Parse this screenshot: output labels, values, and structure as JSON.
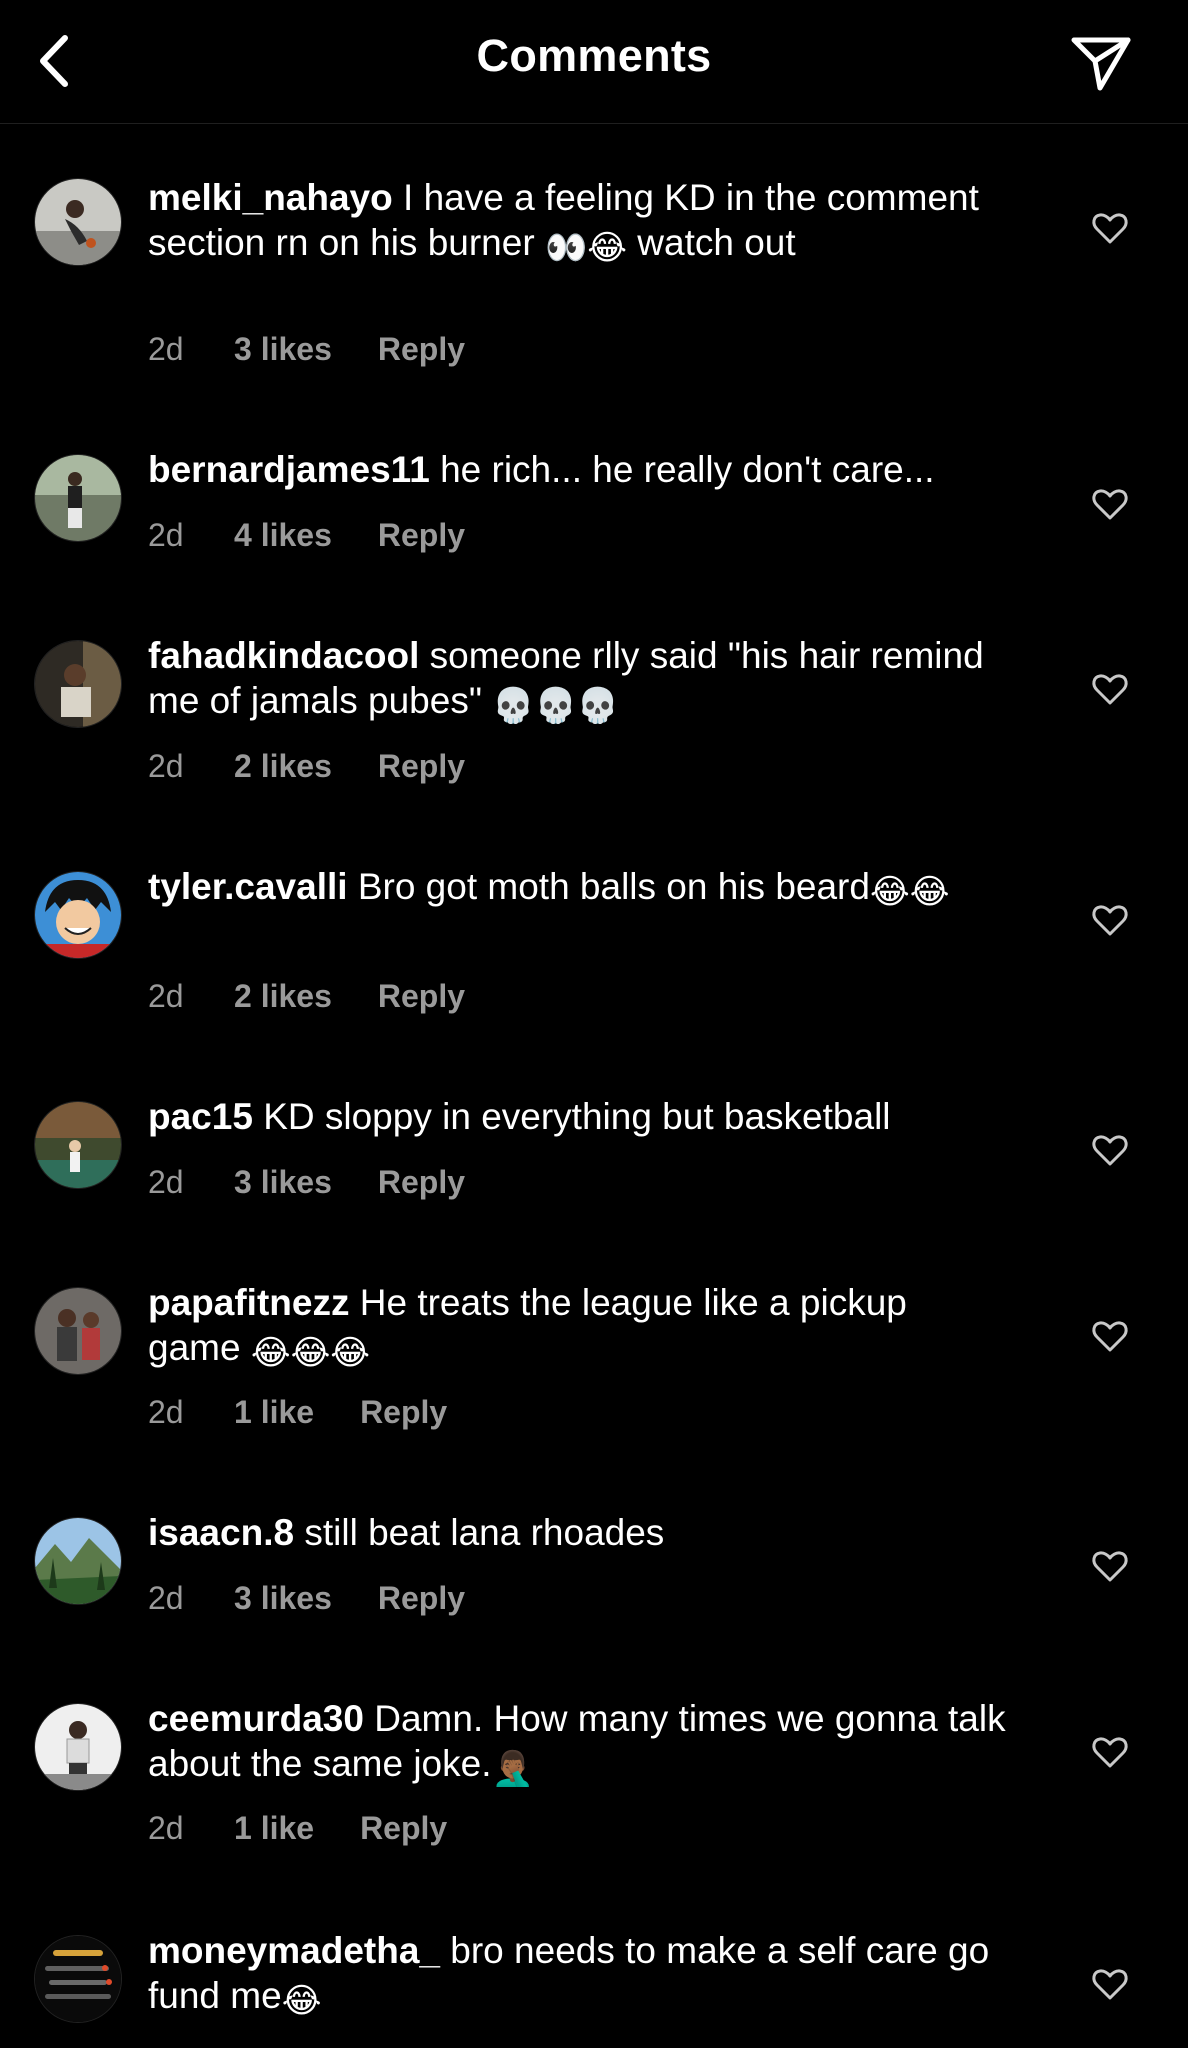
{
  "header": {
    "title": "Comments",
    "back_icon": "chevron-left-icon",
    "share_icon": "paper-plane-icon"
  },
  "colors": {
    "background": "#000000",
    "text": "#ffffff",
    "meta": "#9a9a9a",
    "divider": "#1f1f1f"
  },
  "comments": [
    {
      "username": "melki_nahayo",
      "text_a": "I have a feeling KD in the comment section rn on his burner",
      "emoji_a": "👀😂",
      "text_b": "watch out",
      "time": "2d",
      "likes": "3 likes",
      "reply": "Reply"
    },
    {
      "username": "bernardjames11",
      "text_a": "he rich... he really don't care...",
      "time": "2d",
      "likes": "4 likes",
      "reply": "Reply"
    },
    {
      "username": "fahadkindacool",
      "text_a": "someone rlly said \"his hair remind me of jamals pubes\"",
      "emoji_a": "💀💀💀",
      "time": "2d",
      "likes": "2 likes",
      "reply": "Reply"
    },
    {
      "username": "tyler.cavalli",
      "text_a": "Bro got moth balls on his beard",
      "emoji_a": "😂😂",
      "time": "2d",
      "likes": "2 likes",
      "reply": "Reply"
    },
    {
      "username": "pac15",
      "text_a": "KD sloppy in everything but basketball",
      "time": "2d",
      "likes": "3 likes",
      "reply": "Reply"
    },
    {
      "username": "papafitnezz",
      "text_a": "He treats the league like a pickup game",
      "emoji_a": "😂😂😂",
      "time": "2d",
      "likes": "1 like",
      "reply": "Reply"
    },
    {
      "username": "isaacn.8",
      "text_a": "still beat lana rhoades",
      "time": "2d",
      "likes": "3 likes",
      "reply": "Reply"
    },
    {
      "username": "ceemurda30",
      "text_a": "Damn. How many times we gonna talk about the same joke.",
      "emoji_a": "🤦🏾‍♂️",
      "time": "2d",
      "likes": "1 like",
      "reply": "Reply"
    },
    {
      "username": "moneymadetha_",
      "text_a": "bro needs to make a self care go fund me",
      "emoji_a": "😂"
    }
  ]
}
